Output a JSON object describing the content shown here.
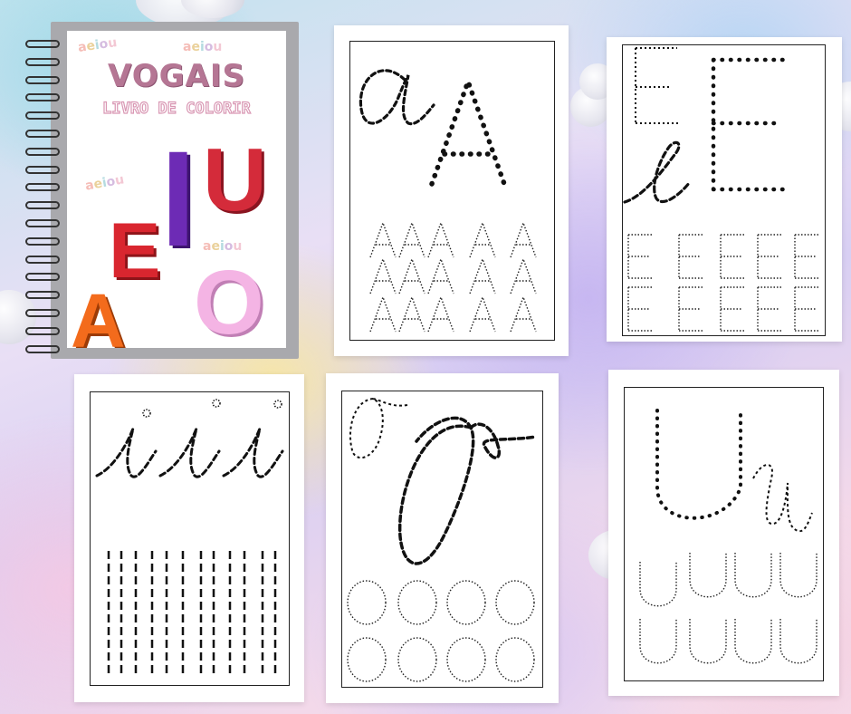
{
  "book": {
    "title": "VOGAIS",
    "subtitle": "LIVRO DE COLORIR",
    "decor_text": "aeiou",
    "letters": {
      "a": "A",
      "e": "E",
      "i": "I",
      "o": "O",
      "u": "U"
    },
    "colors": {
      "a": "#f36b1c",
      "e": "#d9262f",
      "i": "#6d2bb5",
      "o": "#f4b4e4",
      "u": "#d42b3a",
      "title": "#b57694"
    }
  },
  "worksheets": [
    {
      "id": "a",
      "cursive": "a",
      "print": "A",
      "practice_letter": "A"
    },
    {
      "id": "e",
      "cursive": "e",
      "print": "E",
      "practice_letter": "E"
    },
    {
      "id": "i",
      "cursive": "i",
      "practice": "dashed-lines"
    },
    {
      "id": "o",
      "cursive": "o",
      "print": "O",
      "practice_letter": "O"
    },
    {
      "id": "u",
      "cursive": "u",
      "print": "U",
      "practice_letter": "U"
    }
  ],
  "icons": [
    "spiral-binding-icon",
    "cloud-icon"
  ]
}
